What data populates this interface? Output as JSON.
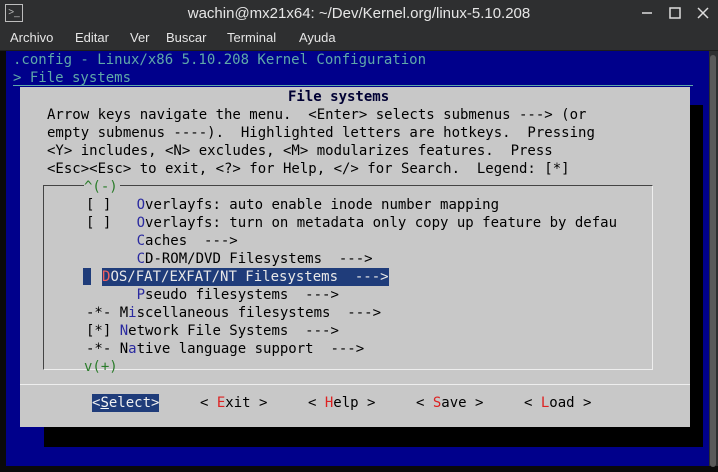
{
  "window": {
    "title": "wachin@mx21x64: ~/Dev/Kernel.org/linux-5.10.208",
    "icon": "terminal-icon"
  },
  "menubar": {
    "items": [
      "Archivo",
      "Editar",
      "Ver",
      "Buscar",
      "Terminal",
      "Ayuda"
    ]
  },
  "terminal": {
    "header_line1": ".config - Linux/x86 5.10.208 Kernel Configuration",
    "header_line2": "> File systems"
  },
  "dialog": {
    "title": "File systems",
    "help_text": "Arrow keys navigate the menu.  <Enter> selects submenus ---> (or\nempty submenus ----).  Highlighted letters are hotkeys.  Pressing\n<Y> includes, <N> excludes, <M> modularizes features.  Press\n<Esc><Esc> to exit, <?> for Help, </> for Search.  Legend: [*]",
    "scroll_up": "^(-)",
    "scroll_down": "v(+)",
    "items": [
      {
        "prefix": "[ ]   ",
        "hotkey": "O",
        "rest": "verlayfs: auto enable inode number mapping"
      },
      {
        "prefix": "[ ]   ",
        "hotkey": "O",
        "rest": "verlayfs: turn on metadata only copy up feature by defau"
      },
      {
        "prefix": "      ",
        "hotkey": "C",
        "rest": "aches  --->"
      },
      {
        "prefix": "      ",
        "hotkey": "C",
        "rest": "D-ROM/DVD Filesystems  --->"
      },
      {
        "prefix": "      ",
        "hotkey": "D",
        "rest": "OS/FAT/EXFAT/NT Filesystems  --->"
      },
      {
        "prefix": "      ",
        "hotkey": "P",
        "rest": "seudo filesystems  --->"
      },
      {
        "prefix": "-*- ",
        "pre": "M",
        "hotkey": "i",
        "rest": "scellaneous filesystems  --->"
      },
      {
        "prefix": "[*] ",
        "hotkey": "N",
        "rest": "etwork File Systems  --->"
      },
      {
        "prefix": "-*- ",
        "pre": "N",
        "hotkey": "a",
        "rest": "tive language support  --->"
      }
    ],
    "buttons": [
      {
        "open": "<",
        "hotkey": "S",
        "rest": "elect",
        "close": ">"
      },
      {
        "open": "< ",
        "hotkey": "E",
        "rest": "xit",
        "close": " >"
      },
      {
        "open": "< ",
        "hotkey": "H",
        "rest": "elp",
        "close": " >"
      },
      {
        "open": "< ",
        "hotkey": "S",
        "rest": "ave",
        "close": " >"
      },
      {
        "open": "< ",
        "hotkey": "L",
        "rest": "oad",
        "close": " >"
      }
    ]
  },
  "colors": {
    "terminal_bg": "#00008b",
    "dialog_bg": "#c8c8c8",
    "selection_bg": "#1f3c7a",
    "header_fg": "#5fa8a8",
    "hotkey_fg": "#2a2aa0",
    "scroll_indicator": "#2a7c2a"
  }
}
